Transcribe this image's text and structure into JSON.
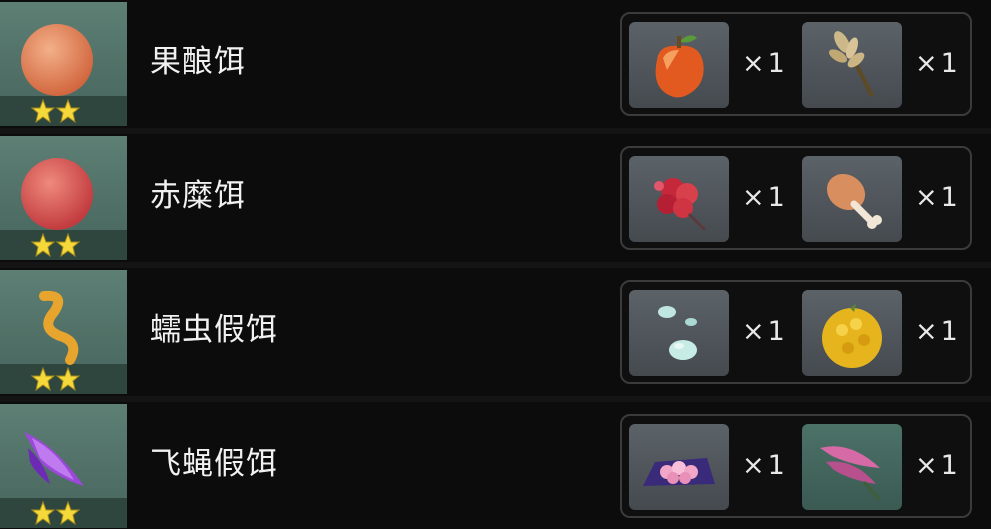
{
  "recipes": [
    {
      "name": "果酿饵",
      "item_icon": "orange-ball-icon",
      "materials": [
        {
          "icon": "apple-icon",
          "qty": "×1"
        },
        {
          "icon": "wheat-icon",
          "qty": "×1"
        }
      ]
    },
    {
      "name": "赤糜饵",
      "item_icon": "red-ball-icon",
      "materials": [
        {
          "icon": "red-flower-icon",
          "qty": "×1"
        },
        {
          "icon": "drumstick-icon",
          "qty": "×1"
        }
      ]
    },
    {
      "name": "蠕虫假饵",
      "item_icon": "worm-icon",
      "materials": [
        {
          "icon": "slime-drops-icon",
          "qty": "×1"
        },
        {
          "icon": "yellow-berry-icon",
          "qty": "×1"
        }
      ]
    },
    {
      "name": "飞蝇假饵",
      "item_icon": "purple-fly-icon",
      "materials": [
        {
          "icon": "pink-coral-cloth-icon",
          "qty": "×1"
        },
        {
          "icon": "pink-feather-icon",
          "qty": "×1"
        }
      ]
    }
  ],
  "rarity_stars": 2,
  "colors": {
    "row_bg": "#0c0c0d",
    "thumb_bg": "#5d7f74",
    "star": "#f5d83a",
    "text": "#f1f1f1"
  }
}
